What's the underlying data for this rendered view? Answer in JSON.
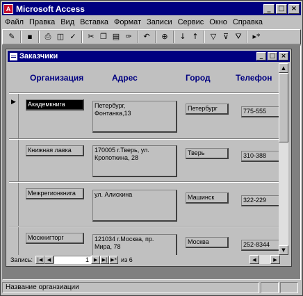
{
  "app": {
    "title": "Microsoft Access",
    "icon_letter": "A",
    "window_buttons": [
      "_",
      "□",
      "×"
    ]
  },
  "menu": [
    "Файл",
    "Правка",
    "Вид",
    "Вставка",
    "Формат",
    "Записи",
    "Сервис",
    "Окно",
    "Справка"
  ],
  "toolbar_icons": [
    "design-view-icon",
    "save-icon",
    "print-icon",
    "print-preview-icon",
    "spelling-icon",
    "cut-icon",
    "copy-icon",
    "paste-icon",
    "format-painter-icon",
    "undo-icon",
    "insert-hyperlink-icon",
    "sort-ascending-icon",
    "sort-descending-icon",
    "filter-by-selection-icon",
    "filter-by-form-icon",
    "apply-filter-icon",
    "new-record-icon"
  ],
  "form": {
    "title": "Заказчики",
    "window_buttons": [
      "_",
      "□",
      "×"
    ],
    "headers": {
      "org": "Организация",
      "address": "Адрес",
      "city": "Город",
      "phone": "Телефон"
    },
    "current_record_marker": "▶",
    "records": [
      {
        "org": "Академкнига",
        "address_line1": "Петербург,",
        "address_line2": "Фонтанка,13",
        "city": "Петербург",
        "phone": "775-555"
      },
      {
        "org": "Книжная лавка",
        "address_line1": "170005 г.Тверь, ул.",
        "address_line2": "Кропоткина, 28",
        "city": "Тверь",
        "phone": "310-388"
      },
      {
        "org": "Межрегионкнига",
        "address_line1": "ул. Алискина",
        "address_line2": "",
        "city": "Машинск",
        "phone": "322-229"
      },
      {
        "org": "Москнигторг",
        "address_line1": "121034 г.Москва, пр.",
        "address_line2": "Мира, 78",
        "city": "Москва",
        "phone": "252-8344"
      }
    ]
  },
  "navigation": {
    "label": "Запись:",
    "current": "1",
    "of_label": "из 6",
    "buttons": [
      "|◀",
      "◀",
      "▶",
      "▶|",
      "▶*"
    ]
  },
  "status": {
    "text": "Название органзиации"
  }
}
